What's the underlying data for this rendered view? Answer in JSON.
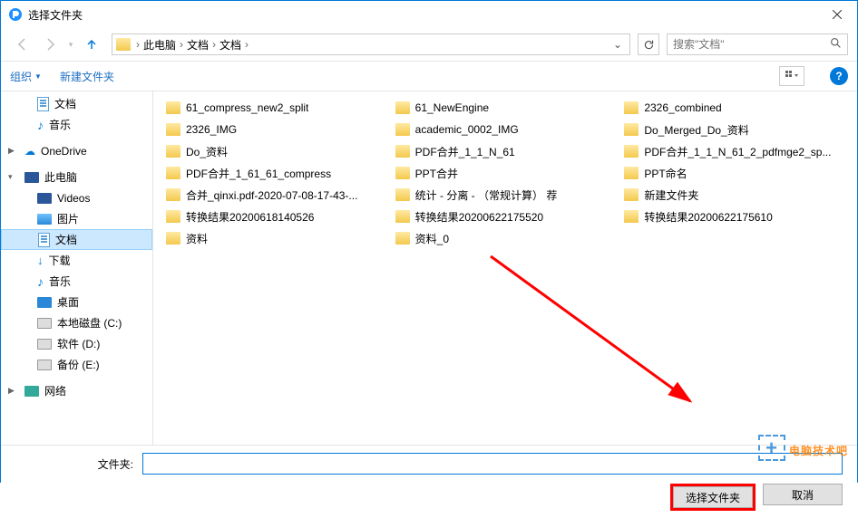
{
  "window": {
    "title": "选择文件夹"
  },
  "breadcrumb": {
    "c0": "此电脑",
    "c1": "文档",
    "c2": "文档"
  },
  "search": {
    "placeholder": "搜索\"文档\""
  },
  "toolbar": {
    "organize": "组织",
    "newfolder": "新建文件夹"
  },
  "sidebar": {
    "doc_top": "文档",
    "music_top": "音乐",
    "onedrive": "OneDrive",
    "thispc": "此电脑",
    "videos": "Videos",
    "pictures": "图片",
    "documents": "文档",
    "downloads": "下载",
    "music": "音乐",
    "desktop": "桌面",
    "diskc": "本地磁盘 (C:)",
    "diskd": "软件 (D:)",
    "diske": "备份 (E:)",
    "network": "网络"
  },
  "files": {
    "f0": "61_compress_new2_split",
    "f1": "61_NewEngine",
    "f2": "2326_combined",
    "f3": "2326_IMG",
    "f4": "academic_0002_IMG",
    "f5": "Do_Merged_Do_资料",
    "f6": "Do_资料",
    "f7": "PDF合并_1_1_N_61",
    "f8": "PDF合并_1_1_N_61_2_pdfmge2_sp...",
    "f9": "PDF合并_1_61_61_compress",
    "f10": "PPT合并",
    "f11": "PPT命名",
    "f12": "合并_qinxi.pdf-2020-07-08-17-43-...",
    "f13": "统计 - 分离 - （常规计算） 荐",
    "f14": "新建文件夹",
    "f15": "转换结果20200618140526",
    "f16": "转换结果20200622175520",
    "f17": "转换结果20200622175610",
    "f18": "资料",
    "f19": "资料_0"
  },
  "footer": {
    "label": "文件夹:",
    "value": "",
    "select": "选择文件夹",
    "cancel": "取消"
  },
  "watermark": "电脑技术吧"
}
